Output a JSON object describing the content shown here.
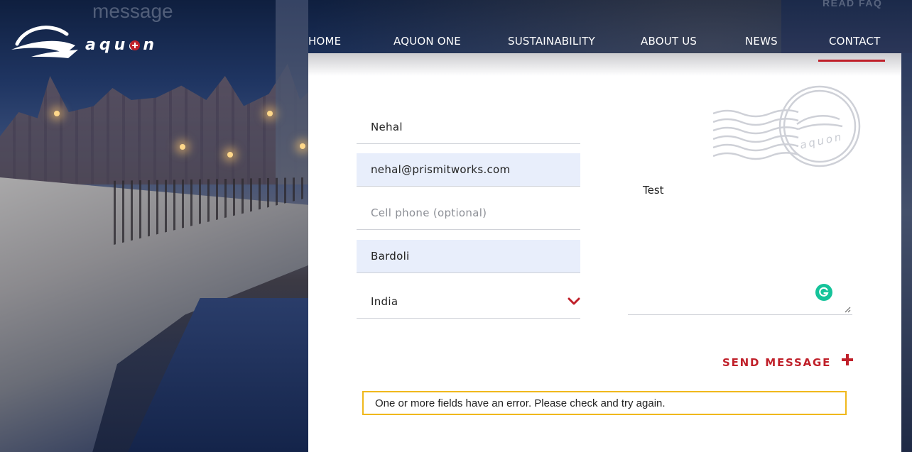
{
  "brand": {
    "logo_text": "aquon"
  },
  "background": {
    "ghost_heading": "message",
    "read_faq": "READ FAQ"
  },
  "nav": {
    "items": [
      {
        "label": "HOME"
      },
      {
        "label": "AQUON ONE"
      },
      {
        "label": "SUSTAINABILITY"
      },
      {
        "label": "ABOUT US"
      },
      {
        "label": "NEWS"
      },
      {
        "label": "CONTACT",
        "active": true
      }
    ]
  },
  "form": {
    "name": {
      "value": "Nehal"
    },
    "email": {
      "value": "nehal@prismitworks.com"
    },
    "phone": {
      "value": "",
      "placeholder": "Cell phone (optional)"
    },
    "city": {
      "value": "Bardoli"
    },
    "country": {
      "value": "India"
    },
    "message": {
      "value": "Test"
    },
    "send_label": "SEND MESSAGE",
    "error_text": "One or more fields have an error. Please check and try again."
  },
  "colors": {
    "accent": "#c0202a",
    "autofill_bg": "#e8eefb",
    "error_border": "#f0b81c",
    "grammarly": "#15c39a"
  },
  "icons": {
    "dropdown": "chevron-down-icon",
    "send": "plus-icon",
    "grammarly": "grammarly-icon",
    "stamp": "postmark-stamp-icon"
  }
}
